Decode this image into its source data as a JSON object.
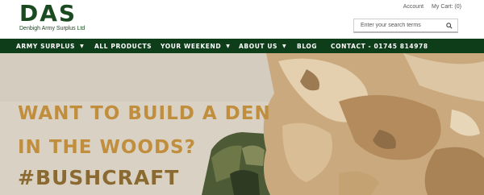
{
  "brand": {
    "logo_text": "DAS",
    "tagline": "Denbigh Army Surplus Ltd"
  },
  "account_links": {
    "account": "Account",
    "cart": "My Cart: (0)"
  },
  "search": {
    "placeholder": "Enter your search terms",
    "value": ""
  },
  "nav": {
    "items": [
      {
        "label": "ARMY SURPLUS",
        "dropdown": true
      },
      {
        "label": "ALL PRODUCTS",
        "dropdown": false
      },
      {
        "label": "YOUR WEEKEND",
        "dropdown": true
      },
      {
        "label": "ABOUT US",
        "dropdown": true
      },
      {
        "label": "BLOG",
        "dropdown": false
      },
      {
        "label": "CONTACT - 01745 814978",
        "dropdown": false
      }
    ]
  },
  "hero": {
    "line1": "WANT TO BUILD A DEN",
    "line2": "IN THE WOODS?",
    "line3": "#BUSHCRAFT"
  },
  "colors": {
    "nav_bg": "#0e3d1a",
    "brand_green": "#1a4a1f",
    "headline_gold": "#c08e3c",
    "hashtag_brown": "#8a6a31",
    "hero_bg": "#d9d2c6"
  },
  "icons": {
    "search": "search-icon",
    "dropdown": "chevron-down-icon"
  }
}
